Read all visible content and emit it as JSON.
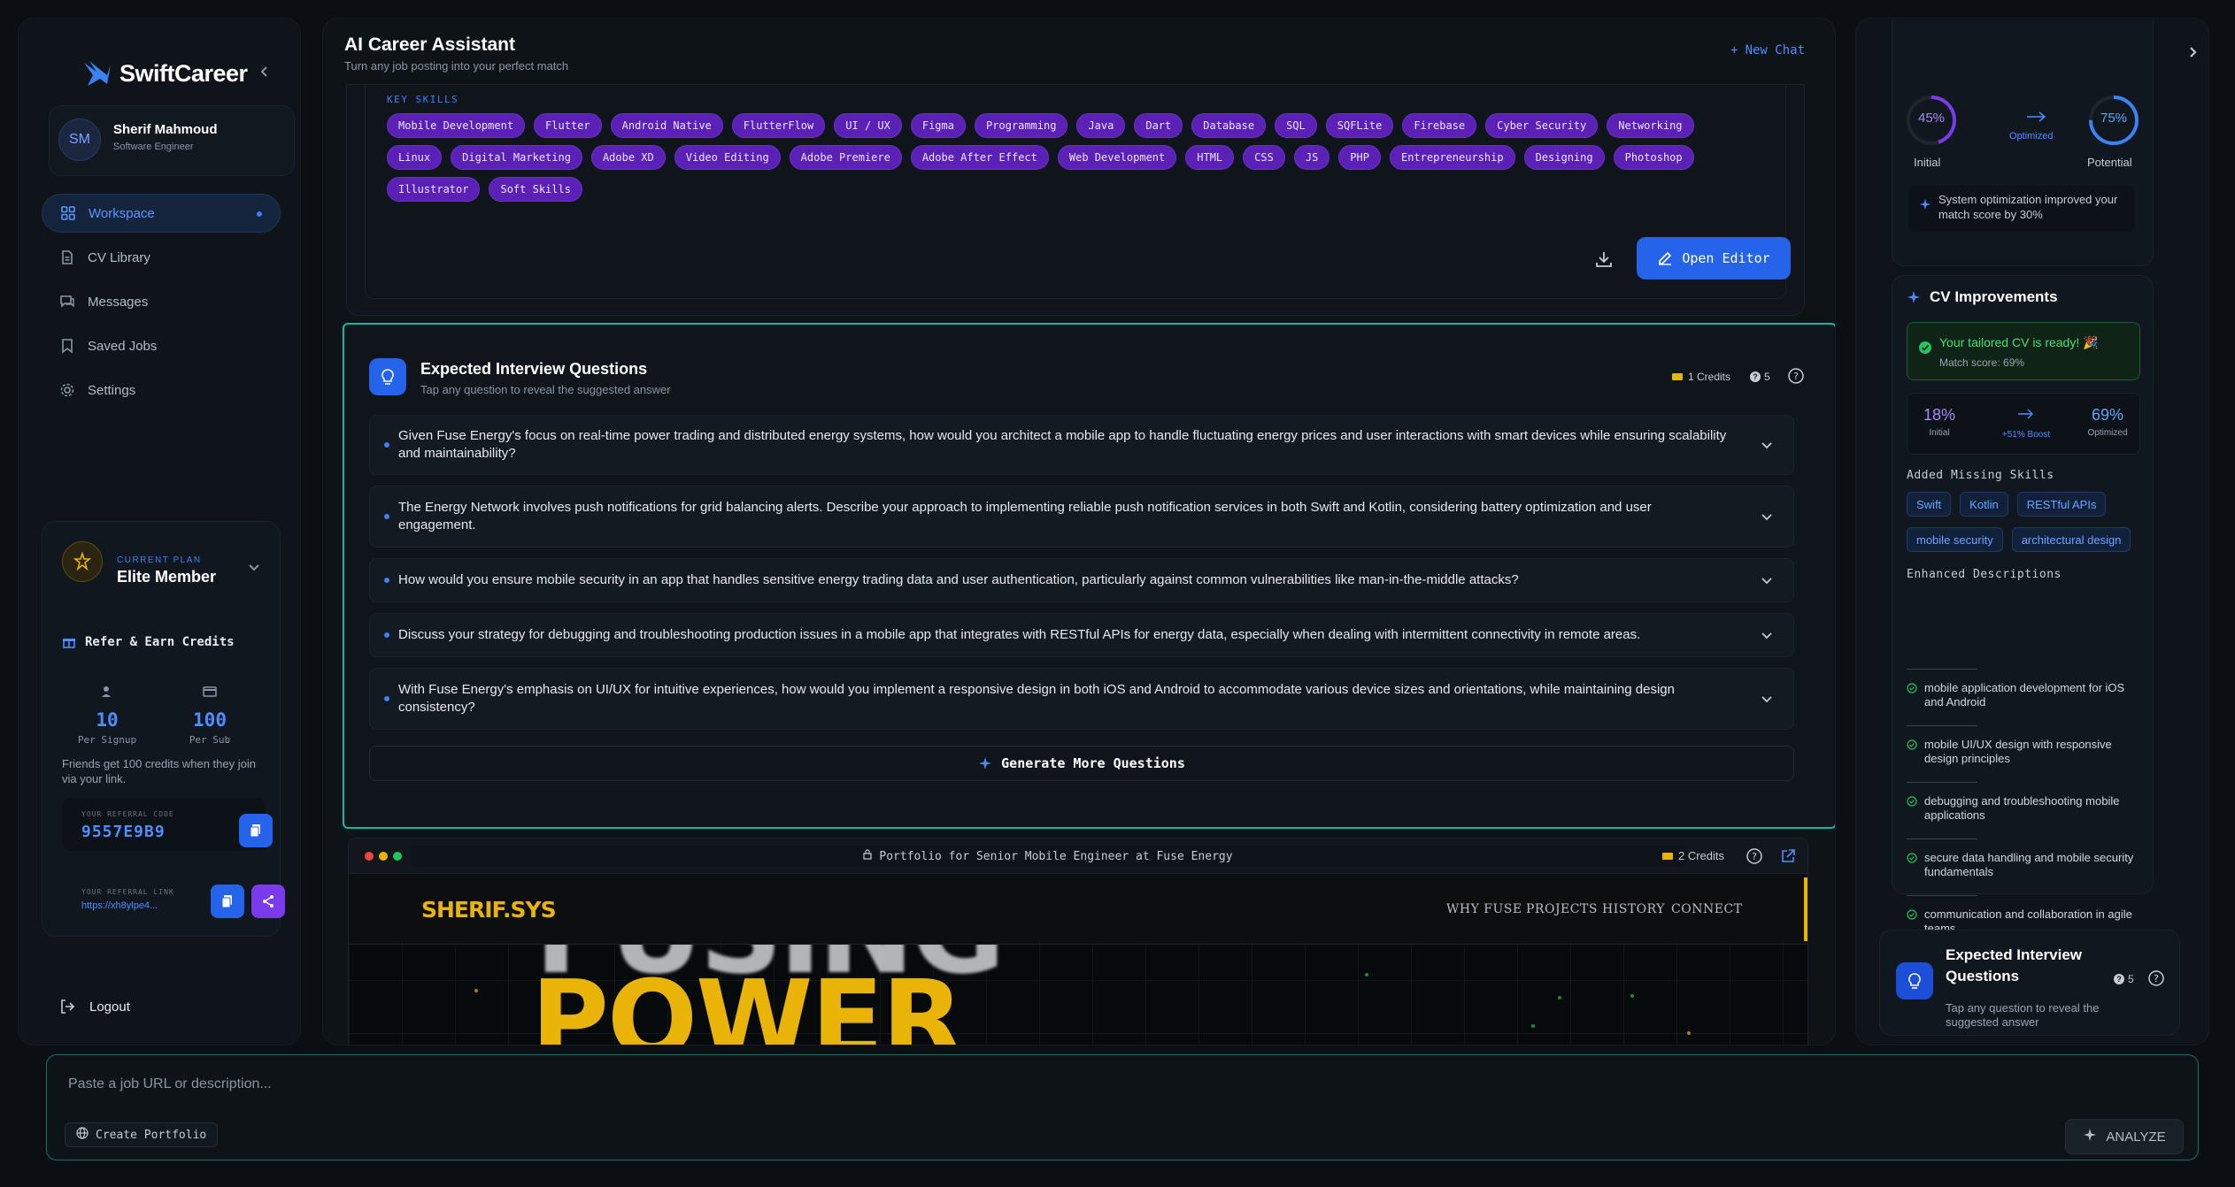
{
  "app": {
    "name": "SwiftCareer"
  },
  "user": {
    "initials": "SM",
    "name": "Sherif Mahmoud",
    "role": "Software Engineer"
  },
  "nav": [
    {
      "label": "Workspace",
      "icon": "grid-icon",
      "active": true
    },
    {
      "label": "CV Library",
      "icon": "document-icon"
    },
    {
      "label": "Messages",
      "icon": "chat-icon"
    },
    {
      "label": "Saved Jobs",
      "icon": "bookmark-icon"
    },
    {
      "label": "Settings",
      "icon": "gear-icon"
    }
  ],
  "plan": {
    "label": "CURRENT PLAN",
    "name": "Elite Member"
  },
  "refer": {
    "title": "Refer & Earn Credits",
    "signup_value": "10",
    "signup_label": "Per Signup",
    "sub_value": "100",
    "sub_label": "Per Sub",
    "desc": "Friends get 100 credits when they join via your link.",
    "code_label": "YOUR REFERRAL CODE",
    "code": "9557E9B9",
    "link_label": "YOUR REFERRAL LINK",
    "link": "https://xh8ylpe4..."
  },
  "logout": "Logout",
  "header": {
    "title": "AI Career Assistant",
    "subtitle": "Turn any job posting into your perfect match",
    "new_chat": "New Chat"
  },
  "cv": {
    "skills_title": "KEY SKILLS",
    "skills": [
      "Mobile Development",
      "Flutter",
      "Android Native",
      "FlutterFlow",
      "UI / UX",
      "Figma",
      "Programming",
      "Java",
      "Dart",
      "Database",
      "SQL",
      "SQFLite",
      "Firebase",
      "Cyber Security",
      "Networking",
      "Linux",
      "Digital Marketing",
      "Adobe XD",
      "Video Editing",
      "Adobe Premiere",
      "Adobe After Effect",
      "Web Development",
      "HTML",
      "CSS",
      "JS",
      "PHP",
      "Entrepreneurship",
      "Designing",
      "Photoshop",
      "Illustrator",
      "Soft Skills"
    ],
    "open_editor": "Open Editor"
  },
  "interview": {
    "title": "Expected Interview Questions",
    "subtitle": "Tap any question to reveal the suggested answer",
    "credits": "1 Credits",
    "count": "5",
    "questions": [
      "Given Fuse Energy's focus on real-time power trading and distributed energy systems, how would you architect a mobile app to handle fluctuating energy prices and user interactions with smart devices while ensuring scalability and maintainability?",
      "The Energy Network involves push notifications for grid balancing alerts. Describe your approach to implementing reliable push notification services in both Swift and Kotlin, considering battery optimization and user engagement.",
      "How would you ensure mobile security in an app that handles sensitive energy trading data and user authentication, particularly against common vulnerabilities like man-in-the-middle attacks?",
      "Discuss your strategy for debugging and troubleshooting production issues in a mobile app that integrates with RESTful APIs for energy data, especially when dealing with intermittent connectivity in remote areas.",
      "With Fuse Energy's emphasis on UI/UX for intuitive experiences, how would you implement a responsive design in both iOS and Android to accommodate various device sizes and orientations, while maintaining design consistency?"
    ],
    "generate_more": "Generate More Questions"
  },
  "portfolio": {
    "url_text": "Portfolio for Senior Mobile Engineer at Fuse Energy",
    "credits": "2 Credits",
    "site_logo": "SHERIF.SYS",
    "site_links": [
      "WHY FUSE",
      "PROJECTS",
      "HISTORY",
      "CONNECT"
    ],
    "hero_line1": "FUSING",
    "hero_line2": "POWER"
  },
  "ats": {
    "initial_value": "45%",
    "initial_label": "Initial",
    "potential_value": "75%",
    "potential_label": "Potential",
    "optimized_label": "Optimized",
    "note": "System optimization improved your match score by 30%"
  },
  "cv_improvements": {
    "title": "CV Improvements",
    "ready_title": "Your tailored CV is ready! 🎉",
    "ready_sub": "Match score: 69%",
    "initial_value": "18%",
    "initial_label": "Initial",
    "boost_label": "+51% Boost",
    "optimized_value": "69%",
    "optimized_label": "Optimized",
    "added_title": "Added Missing Skills",
    "added": [
      "Swift",
      "Kotlin",
      "RESTful APIs",
      "mobile security",
      "architectural design"
    ],
    "enhanced_title": "Enhanced Descriptions",
    "enhanced": [
      "mobile application development for iOS and Android",
      "mobile UI/UX design with responsive design principles",
      "debugging and troubleshooting mobile applications",
      "secure data handling and mobile security fundamentals",
      "communication and collaboration in agile teams"
    ]
  },
  "mini_interview": {
    "title": "Expected Interview Questions",
    "subtitle": "Tap any question to reveal the suggested answer",
    "count": "5"
  },
  "input": {
    "placeholder": "Paste a job URL or description...",
    "create_portfolio": "Create Portfolio",
    "analyze": "ANALYZE"
  },
  "colors": {
    "accent": "#2563eb",
    "skill_chip": "#5b21b6",
    "highlight_border": "#14b8a6",
    "gold": "#eab308"
  }
}
